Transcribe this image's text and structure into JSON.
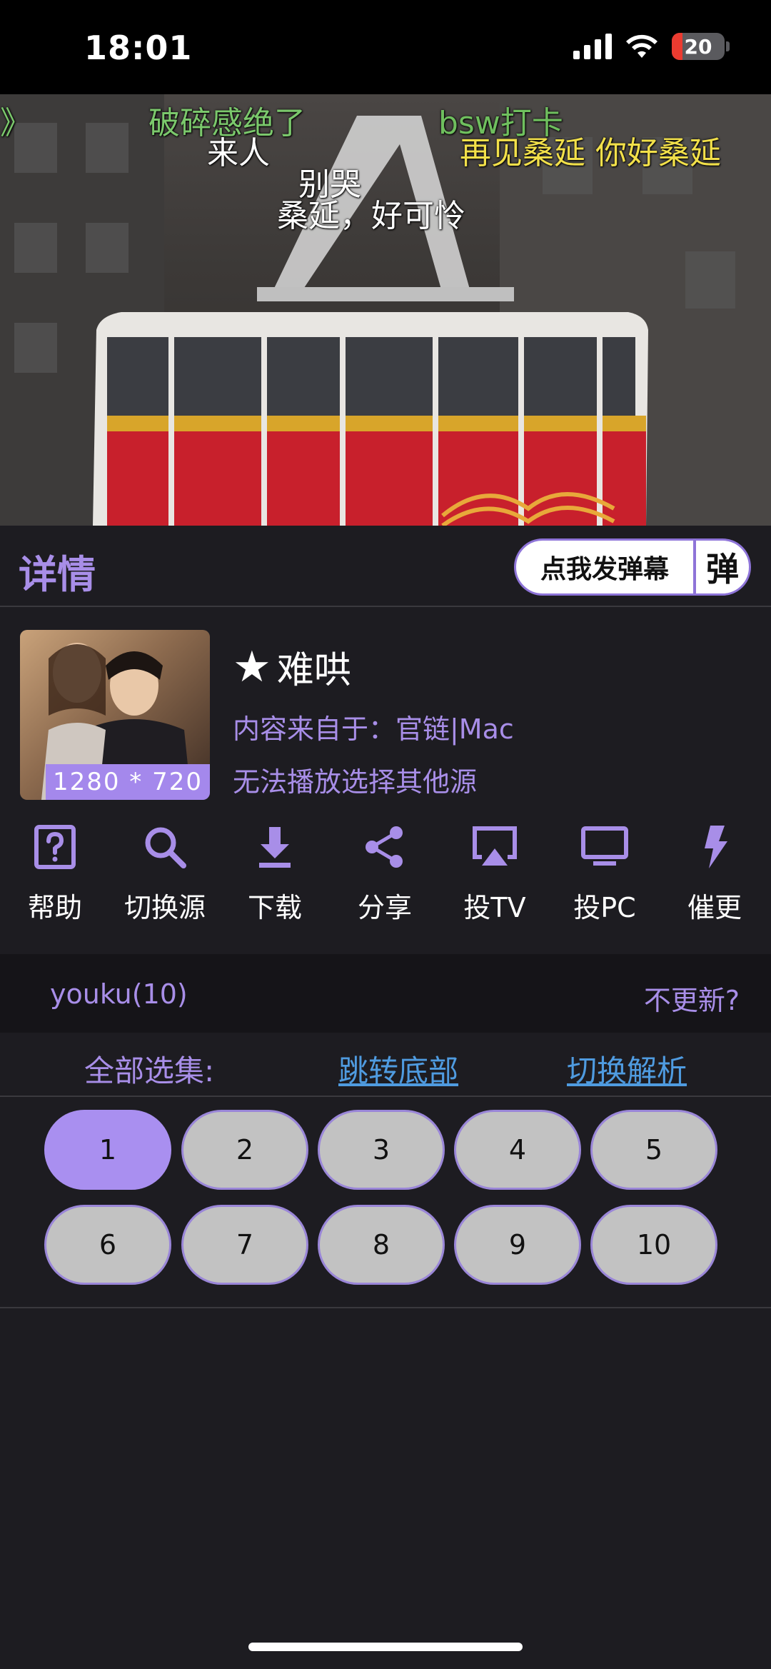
{
  "status_bar": {
    "time": "18:01",
    "battery": "20",
    "battery_level": 0.2
  },
  "video": {
    "danmaku": [
      {
        "text": "》",
        "color": "#7bc86c"
      },
      {
        "text": "破碎感绝了",
        "color": "#7bc86c"
      },
      {
        "text": "bsw打卡",
        "color": "#6fbf5e"
      },
      {
        "text": "来人",
        "color": "#ffffff"
      },
      {
        "text": "再见桑延 你好桑延",
        "color": "#f2e04a"
      },
      {
        "text": "别哭",
        "color": "#ffffff"
      },
      {
        "text": "桑延，好可怜",
        "color": "#ffffff"
      }
    ]
  },
  "detail_header": {
    "title": "详情",
    "danmaku_button": "点我发弹幕",
    "danmaku_tag": "弹"
  },
  "info": {
    "resolution": "1280 * 720",
    "title": "难哄",
    "source_line": "内容来自于：官链|Mac",
    "hint": "无法播放选择其他源"
  },
  "actions": [
    {
      "label": "帮助",
      "icon": "help-icon"
    },
    {
      "label": "切换源",
      "icon": "search-icon"
    },
    {
      "label": "下载",
      "icon": "download-icon"
    },
    {
      "label": "分享",
      "icon": "share-icon"
    },
    {
      "label": "投TV",
      "icon": "airplay-icon"
    },
    {
      "label": "投PC",
      "icon": "monitor-icon"
    },
    {
      "label": "催更",
      "icon": "lightning-icon"
    }
  ],
  "source_bar": {
    "source": "youku(10)",
    "no_update": "不更新?"
  },
  "episodes": {
    "all_label": "全部选集:",
    "jump_bottom": "跳转底部",
    "switch_parse": "切换解析",
    "list": [
      "1",
      "2",
      "3",
      "4",
      "5",
      "6",
      "7",
      "8",
      "9",
      "10"
    ],
    "active": "1"
  },
  "colors": {
    "accent": "#a88ee8",
    "link": "#4f9be0",
    "background": "#1d1c21"
  }
}
